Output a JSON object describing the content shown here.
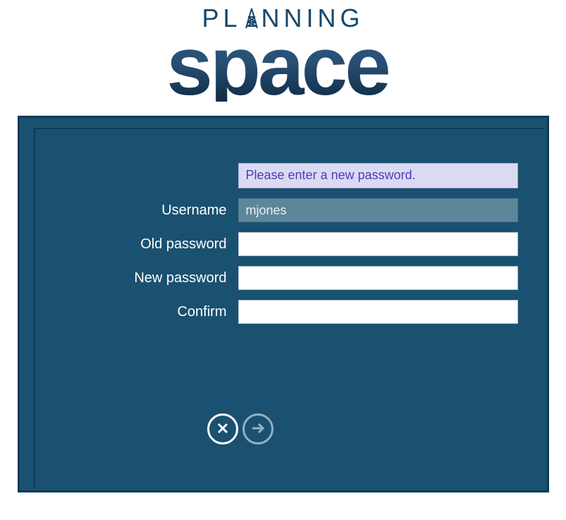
{
  "logo": {
    "line1": "PLANNING",
    "line2": "space",
    "tm": "™"
  },
  "form": {
    "message": "Please enter a new password.",
    "username_label": "Username",
    "username_value": "mjones",
    "old_password_label": "Old password",
    "old_password_value": "",
    "new_password_label": "New password",
    "new_password_value": "",
    "confirm_label": "Confirm",
    "confirm_value": ""
  },
  "actions": {
    "cancel": "Cancel",
    "submit": "Submit"
  }
}
